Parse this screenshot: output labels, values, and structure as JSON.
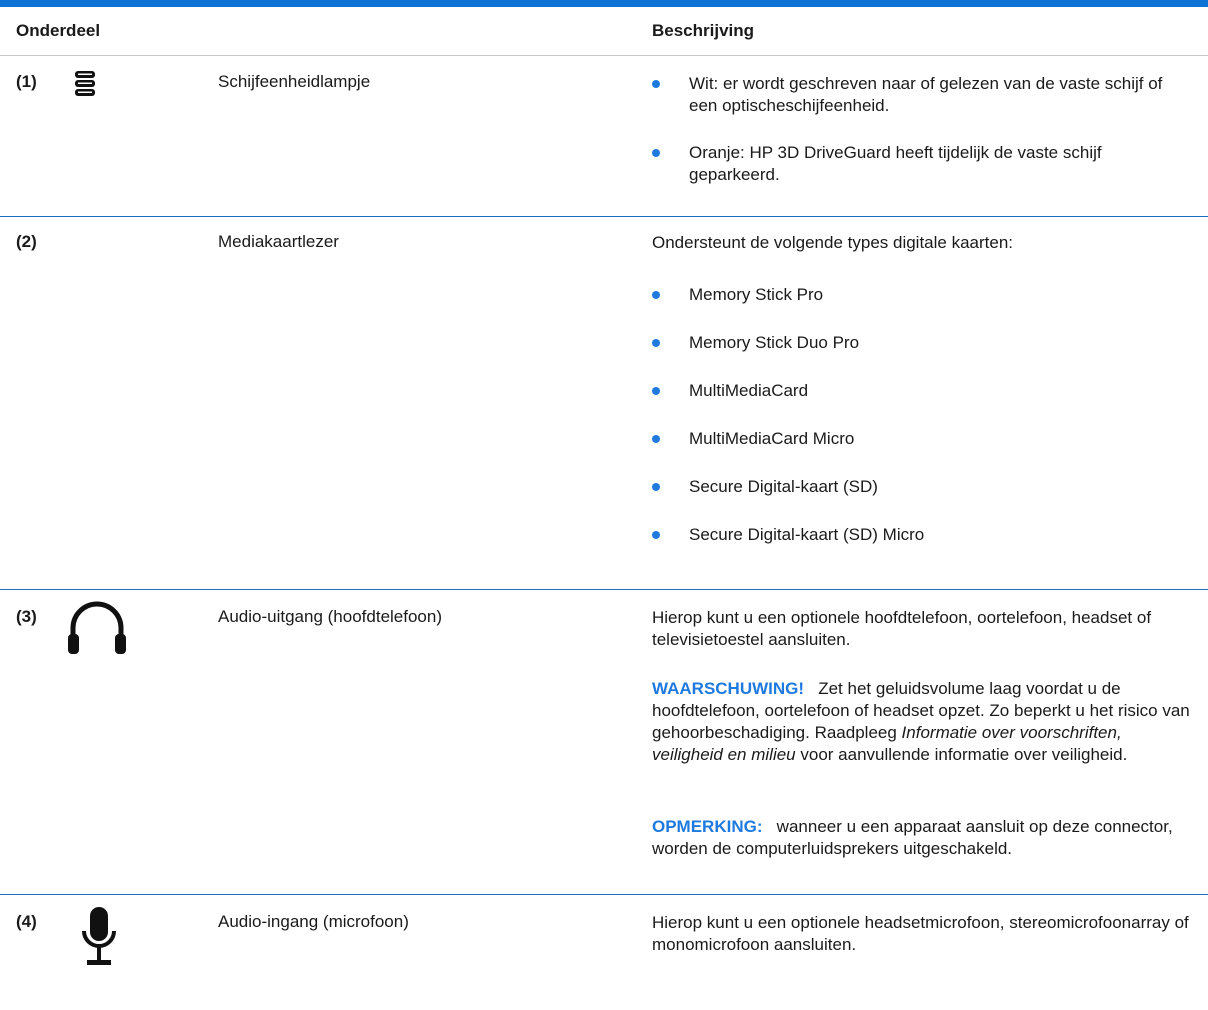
{
  "header": {
    "col1": "Onderdeel",
    "col2": "Beschrijving"
  },
  "rows": [
    {
      "num": "(1)",
      "icon": "hard-drive-light-icon",
      "name": "Schijfeenheidlampje",
      "bullets": [
        "Wit: er wordt geschreven naar of gelezen van de vaste schijf of een optischeschijfeenheid.",
        "Oranje: HP 3D DriveGuard heeft tijdelijk de vaste schijf geparkeerd."
      ]
    },
    {
      "num": "(2)",
      "name": "Mediakaartlezer",
      "intro": "Ondersteunt de volgende types digitale kaarten:",
      "bullets": [
        "Memory Stick Pro",
        "Memory Stick Duo Pro",
        "MultiMediaCard",
        "MultiMediaCard Micro",
        "Secure Digital-kaart (SD)",
        "Secure Digital-kaart (SD) Micro"
      ]
    },
    {
      "num": "(3)",
      "icon": "headphones-icon",
      "name": "Audio-uitgang (hoofdtelefoon)",
      "desc": "Hierop kunt u een optionele hoofdtelefoon, oortelefoon, headset of televisietoestel aansluiten.",
      "warning_label": "WAARSCHUWING!",
      "warning_text_1": "Zet het geluidsvolume laag voordat u de hoofdtelefoon, oortelefoon of headset opzet. Zo beperkt u het risico van gehoorbeschadiging. Raadpleeg",
      "warning_italic": "Informatie over voorschriften, veiligheid en milieu",
      "warning_text_2": "voor aanvullende informatie over veiligheid.",
      "note_label": "OPMERKING:",
      "note_text": "wanneer u een apparaat aansluit op deze connector, worden de computerluidsprekers uitgeschakeld."
    },
    {
      "num": "(4)",
      "icon": "microphone-icon",
      "name": "Audio-ingang (microfoon)",
      "desc": "Hierop kunt u een optionele headsetmicrofoon, stereomicrofoonarray of monomicrofoon aansluiten."
    }
  ]
}
